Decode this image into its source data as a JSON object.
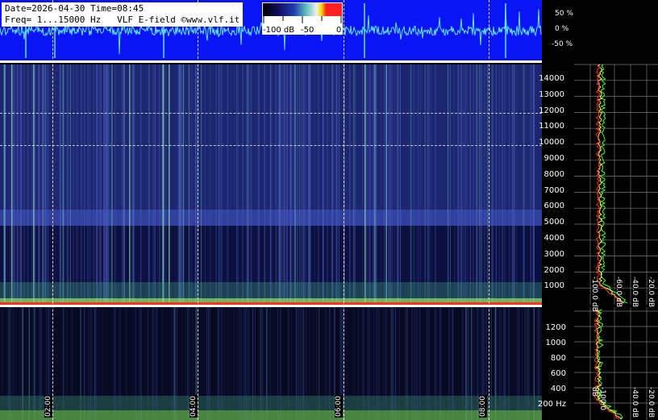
{
  "header": {
    "line1": "Date=2026-04-30 Time=08:45",
    "line2": "Freq= 1...15000 Hz   VLF E-field ©www.vlf.it"
  },
  "color_scale": {
    "labels": [
      "-100 dB",
      "-50",
      "0"
    ]
  },
  "waveform_axis": [
    "50 %",
    "0 %",
    "-50 %"
  ],
  "freq_axis_high": [
    "14000",
    "13000",
    "12000",
    "11000",
    "10000",
    "9000",
    "8000",
    "7000",
    "6000",
    "5000",
    "4000",
    "3000",
    "2000",
    "1000"
  ],
  "freq_axis_low": [
    "1200",
    "1000",
    "800",
    "600",
    "400",
    "200 Hz"
  ],
  "db_labels": [
    "-100.0 dB",
    "-60.0 dB",
    "-40.0 dB",
    "-20.0 dB"
  ],
  "time_labels": [
    "02:00",
    "04:00",
    "06:00",
    "08:00"
  ],
  "colors": {
    "waveform_bg": "#0a14f5",
    "waveform_trace": "#5fe8ff",
    "spectrum_green": "#3cff3c",
    "spectrum_yellow": "#ffff30",
    "spectrum_red": "#ff3030"
  }
}
